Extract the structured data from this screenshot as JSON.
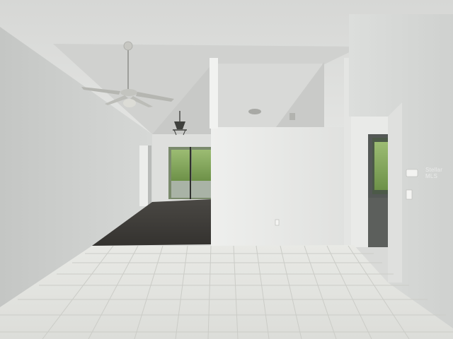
{
  "photo": {
    "watermark_text": "Stellar MLS",
    "colors": {
      "ceiling": "#dcdddb",
      "wall_left": "#cfd1cf",
      "wall_center": "#e6e7e5",
      "wall_right": "#d5d7d5",
      "tile_floor": "#e2e3df",
      "tile_grout": "#c9cbc6",
      "wood_floor": "#3f3d3a",
      "window_green": "#7fa55a",
      "fan_metal": "#c7c7c2"
    }
  }
}
